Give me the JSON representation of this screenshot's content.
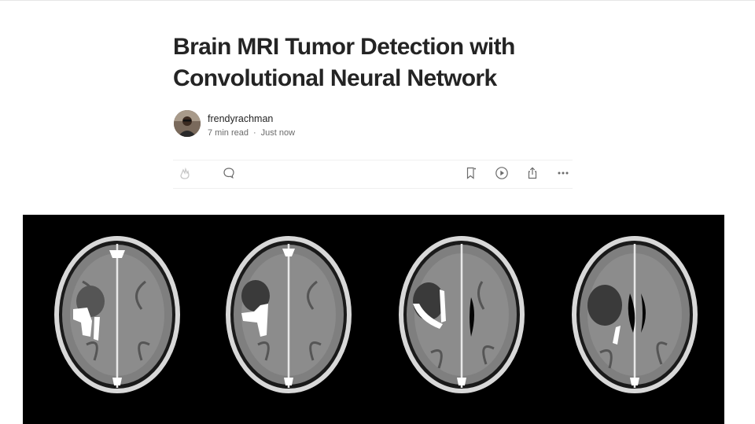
{
  "article": {
    "title_line1": "Brain MRI Tumor Detection with",
    "title_line2": "Convolutional Neural Network"
  },
  "author": {
    "name": "frendyrachman",
    "read_time": "7 min read",
    "separator": "·",
    "published": "Just now"
  },
  "actions": {
    "clap": "clap-icon",
    "comment": "comment-icon",
    "bookmark": "bookmark-icon",
    "listen": "play-icon",
    "share": "share-icon",
    "more": "more-icon"
  },
  "figure": {
    "description_icon": "brain-mri-scans",
    "scan_count": 4
  },
  "colors": {
    "text": "#242424",
    "meta": "#6b6b6b",
    "divider": "#f0f0f0",
    "figure_bg": "#000000"
  }
}
